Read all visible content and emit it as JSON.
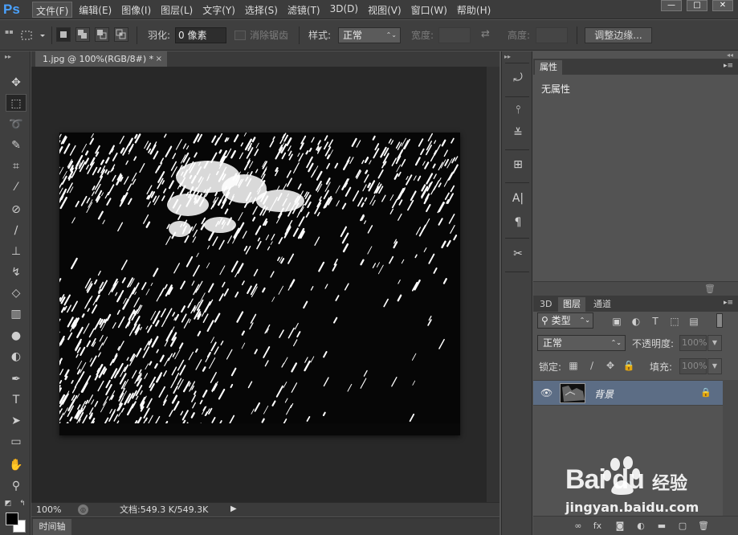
{
  "app": {
    "logo": "Ps",
    "window_controls": [
      "—",
      "□",
      "✕"
    ]
  },
  "menu": [
    "文件(F)",
    "编辑(E)",
    "图像(I)",
    "图层(L)",
    "文字(Y)",
    "选择(S)",
    "滤镜(T)",
    "3D(D)",
    "视图(V)",
    "窗口(W)",
    "帮助(H)"
  ],
  "options": {
    "feather_label": "羽化:",
    "feather_value": "0 像素",
    "antialias_label": "消除锯齿",
    "style_label": "样式:",
    "style_value": "正常",
    "width_label": "宽度:",
    "height_label": "高度:",
    "refine_edge": "调整边缘..."
  },
  "document": {
    "tab_title": "1.jpg @ 100%(RGB/8#) *",
    "tab_close": "×"
  },
  "status": {
    "zoom": "100%",
    "doc_size": "文档:549.3 K/549.3K"
  },
  "timeline": {
    "tab": "时间轴"
  },
  "properties": {
    "tab": "属性",
    "empty_text": "无属性"
  },
  "layers": {
    "tabs": [
      "3D",
      "图层",
      "通道"
    ],
    "filter_kind": "类型",
    "blend_mode": "正常",
    "opacity_label": "不透明度:",
    "opacity_value": "100%",
    "lock_label": "锁定:",
    "fill_label": "填充:",
    "fill_value": "100%",
    "items": [
      {
        "name": "背景",
        "visible": true,
        "locked": true
      }
    ]
  },
  "watermark": {
    "brand": "Bai  du",
    "brand_cn": "经验",
    "url": "jingyan.baidu.com"
  },
  "colors": {
    "foreground": "#000000",
    "background": "#ffffff",
    "layer_selected": "#5c6d85"
  }
}
